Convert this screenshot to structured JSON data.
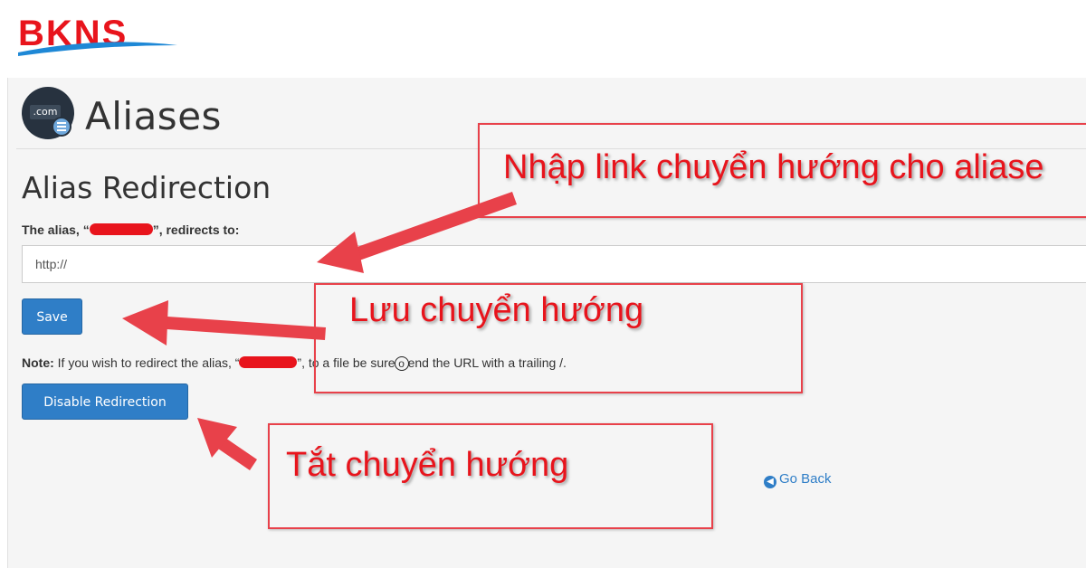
{
  "brand": {
    "name": "BKNS",
    "color": "#e8141c",
    "swoosh_color": "#1e88d6"
  },
  "page": {
    "title": "Aliases",
    "icon": "com-domain-icon",
    "icon_text": ".com"
  },
  "section": {
    "title": "Alias Redirection"
  },
  "alias_label": {
    "prefix": "The alias, “",
    "suffix": "”, redirects to:"
  },
  "url_input": {
    "value": "http://"
  },
  "buttons": {
    "save": "Save",
    "disable": "Disable Redirection"
  },
  "note": {
    "label": "Note:",
    "text_1": " If you wish to redirect the alias, “",
    "text_2": "”, to a file be sure",
    "circled": "o",
    "text_3": "end the URL with a trailing /."
  },
  "go_back": {
    "label": "Go Back",
    "icon": "circle-arrow-left-icon"
  },
  "annotations": [
    {
      "text": "Nhập link chuyển hướng cho aliase"
    },
    {
      "text": "Lưu chuyển hướng"
    },
    {
      "text": "Tắt chuyển hướng"
    }
  ],
  "colors": {
    "accent": "#2f7ec7",
    "annotation": "#e8141c",
    "redaction": "#e8141c"
  }
}
